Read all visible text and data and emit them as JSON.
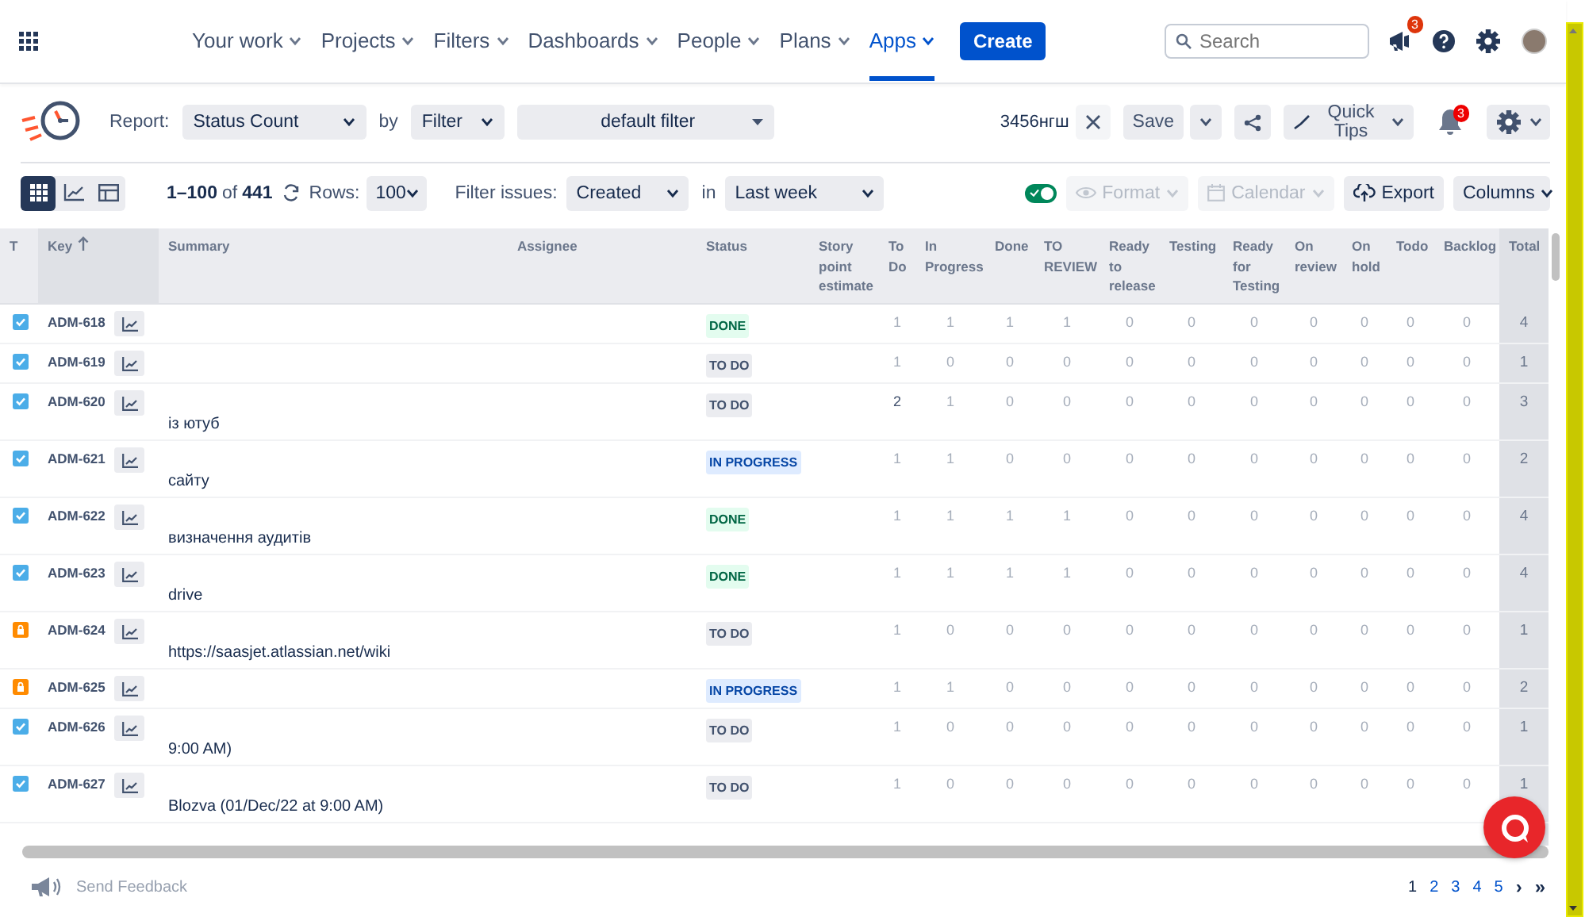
{
  "nav": {
    "items": [
      {
        "label": "Your work",
        "selected": false
      },
      {
        "label": "Projects",
        "selected": false
      },
      {
        "label": "Filters",
        "selected": false
      },
      {
        "label": "Dashboards",
        "selected": false
      },
      {
        "label": "People",
        "selected": false
      },
      {
        "label": "Plans",
        "selected": false
      },
      {
        "label": "Apps",
        "selected": true
      }
    ],
    "create": "Create",
    "search": {
      "placeholder": "Search"
    },
    "notification_count": "3"
  },
  "report_bar": {
    "report_label": "Report:",
    "report": "Status Count",
    "by_label": "by",
    "by": "Filter",
    "filter": "default filter",
    "saved_name": "3456нгш",
    "save": "Save",
    "quick_tips": "Quick Tips",
    "alerts_count": "3"
  },
  "toolbar": {
    "view_modes": [
      {
        "kind": "grid",
        "selected": true
      },
      {
        "kind": "chart",
        "selected": false
      },
      {
        "kind": "panel",
        "selected": false
      }
    ],
    "range": "1–100",
    "of": "of",
    "total": "441",
    "rows_label": "Rows:",
    "rows": "100",
    "filter_label": "Filter issues:",
    "filter_field": "Created",
    "in_label": "in",
    "period": "Last week",
    "toggle_on": true,
    "buttons": [
      {
        "kind": "format",
        "label": "Format",
        "disabled": true
      },
      {
        "kind": "calendar",
        "label": "Calendar",
        "disabled": true
      },
      {
        "kind": "export",
        "label": "Export",
        "disabled": false
      },
      {
        "kind": "columns",
        "label": "Columns",
        "disabled": false
      }
    ]
  },
  "table": {
    "columns": [
      {
        "label": "T",
        "sorted": false
      },
      {
        "label": "Key",
        "sorted": true
      },
      {
        "label": "Summary",
        "sorted": false
      },
      {
        "label": "Assignee",
        "sorted": false
      },
      {
        "label": "Status",
        "sorted": false
      },
      {
        "label": "Story point estimate",
        "sorted": false
      },
      {
        "label": "To Do",
        "sorted": false
      },
      {
        "label": "In Progress",
        "sorted": false
      },
      {
        "label": "Done",
        "sorted": false
      },
      {
        "label": "TO REVIEW",
        "sorted": false
      },
      {
        "label": "Ready to release",
        "sorted": false
      },
      {
        "label": "Testing",
        "sorted": false
      },
      {
        "label": "Ready for Testing",
        "sorted": false
      },
      {
        "label": "On review",
        "sorted": false
      },
      {
        "label": "On hold",
        "sorted": false
      },
      {
        "label": "Todo",
        "sorted": false
      },
      {
        "label": "Backlog",
        "sorted": false
      },
      {
        "label": "Total",
        "sorted": false
      }
    ],
    "rows": [
      {
        "kind": "story",
        "key": "ADM-618",
        "status": {
          "label": "DONE",
          "kind": "done"
        },
        "counts": [
          "1",
          "1",
          "1",
          "1",
          "0",
          "0",
          "0",
          "0",
          "0",
          "0",
          "0"
        ],
        "total": "4"
      },
      {
        "kind": "story",
        "key": "ADM-619",
        "status": {
          "label": "TO DO",
          "kind": "todo"
        },
        "counts": [
          "1",
          "0",
          "0",
          "0",
          "0",
          "0",
          "0",
          "0",
          "0",
          "0",
          "0"
        ],
        "total": "1"
      },
      {
        "kind": "story",
        "key": "ADM-620",
        "summary": "із ютуб",
        "status": {
          "label": "TO DO",
          "kind": "todo"
        },
        "counts": [
          "2",
          "1",
          "0",
          "0",
          "0",
          "0",
          "0",
          "0",
          "0",
          "0",
          "0"
        ],
        "total": "3"
      },
      {
        "kind": "story",
        "key": "ADM-621",
        "summary": "сайту",
        "status": {
          "label": "IN PROGRESS",
          "kind": "progress"
        },
        "counts": [
          "1",
          "1",
          "0",
          "0",
          "0",
          "0",
          "0",
          "0",
          "0",
          "0",
          "0"
        ],
        "total": "2"
      },
      {
        "kind": "story",
        "key": "ADM-622",
        "summary": "визначення аудитів",
        "status": {
          "label": "DONE",
          "kind": "done"
        },
        "counts": [
          "1",
          "1",
          "1",
          "1",
          "0",
          "0",
          "0",
          "0",
          "0",
          "0",
          "0"
        ],
        "total": "4"
      },
      {
        "kind": "story",
        "key": "ADM-623",
        "summary": "drive",
        "status": {
          "label": "DONE",
          "kind": "done"
        },
        "counts": [
          "1",
          "1",
          "1",
          "1",
          "0",
          "0",
          "0",
          "0",
          "0",
          "0",
          "0"
        ],
        "total": "4"
      },
      {
        "kind": "task",
        "key": "ADM-624",
        "summary": "https://saasjet.atlassian.net/wiki",
        "status": {
          "label": "TO DO",
          "kind": "todo"
        },
        "counts": [
          "1",
          "0",
          "0",
          "0",
          "0",
          "0",
          "0",
          "0",
          "0",
          "0",
          "0"
        ],
        "total": "1"
      },
      {
        "kind": "task",
        "key": "ADM-625",
        "status": {
          "label": "IN PROGRESS",
          "kind": "progress"
        },
        "counts": [
          "1",
          "1",
          "0",
          "0",
          "0",
          "0",
          "0",
          "0",
          "0",
          "0",
          "0"
        ],
        "total": "2"
      },
      {
        "kind": "story",
        "key": "ADM-626",
        "summary": "9:00 AM)",
        "status": {
          "label": "TO DO",
          "kind": "todo"
        },
        "counts": [
          "1",
          "0",
          "0",
          "0",
          "0",
          "0",
          "0",
          "0",
          "0",
          "0",
          "0"
        ],
        "total": "1"
      },
      {
        "kind": "story",
        "key": "ADM-627",
        "summary": "Blozva (01/Dec/22 at 9:00 AM)",
        "status": {
          "label": "TO DO",
          "kind": "todo"
        },
        "counts": [
          "1",
          "0",
          "0",
          "0",
          "0",
          "0",
          "0",
          "0",
          "0",
          "0",
          "0"
        ],
        "total": "1"
      }
    ]
  },
  "footer": {
    "feedback": "Send Feedback",
    "pages": [
      {
        "label": "1",
        "selected": true
      },
      {
        "label": "2",
        "selected": false
      },
      {
        "label": "3",
        "selected": false
      },
      {
        "label": "4",
        "selected": false
      },
      {
        "label": "5",
        "selected": false
      }
    ],
    "next": "›",
    "last": "»"
  }
}
